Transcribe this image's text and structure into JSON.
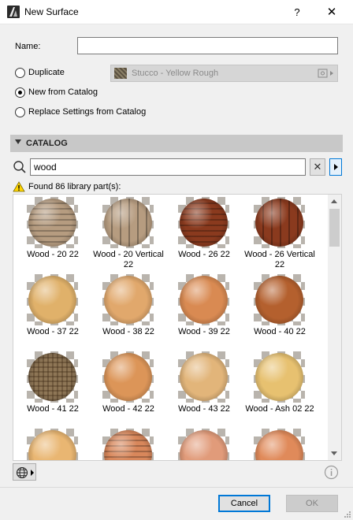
{
  "window": {
    "title": "New Surface",
    "help_label": "?",
    "close_label": "✕"
  },
  "form": {
    "name_label": "Name:",
    "name_value": "",
    "options": [
      {
        "label": "Duplicate",
        "checked": false
      },
      {
        "label": "New from Catalog",
        "checked": true
      },
      {
        "label": "Replace Settings from Catalog",
        "checked": false
      }
    ],
    "duplicate_select": {
      "value": "Stucco - Yellow Rough"
    }
  },
  "catalog": {
    "section_title": "CATALOG",
    "search_value": "wood",
    "clear_label": "✕",
    "result_text": "Found 86 library part(s):",
    "items": [
      {
        "label": "Wood - 20 22",
        "color": "#b69c80"
      },
      {
        "label": "Wood - 20 Vertical 22",
        "color": "#b69c80"
      },
      {
        "label": "Wood - 26 22",
        "color": "#8a3a1e"
      },
      {
        "label": "Wood - 26 Vertical 22",
        "color": "#8a3a1e"
      },
      {
        "label": "Wood - 37 22",
        "color": "#e0b16a"
      },
      {
        "label": "Wood - 38 22",
        "color": "#e1a86c"
      },
      {
        "label": "Wood - 39 22",
        "color": "#d98a52"
      },
      {
        "label": "Wood - 40 22",
        "color": "#b4602e"
      },
      {
        "label": "Wood - 41 22",
        "color": "#8e7656"
      },
      {
        "label": "Wood - 42 22",
        "color": "#dc9558"
      },
      {
        "label": "Wood - 43 22",
        "color": "#e2b57a"
      },
      {
        "label": "Wood - Ash 02 22",
        "color": "#e7c170"
      },
      {
        "label": "",
        "color": "#e9b672"
      },
      {
        "label": "",
        "color": "#d8875b"
      },
      {
        "label": "",
        "color": "#e19b7a"
      },
      {
        "label": "",
        "color": "#e08a5a"
      }
    ]
  },
  "footer": {
    "cancel_label": "Cancel",
    "ok_label": "OK"
  }
}
